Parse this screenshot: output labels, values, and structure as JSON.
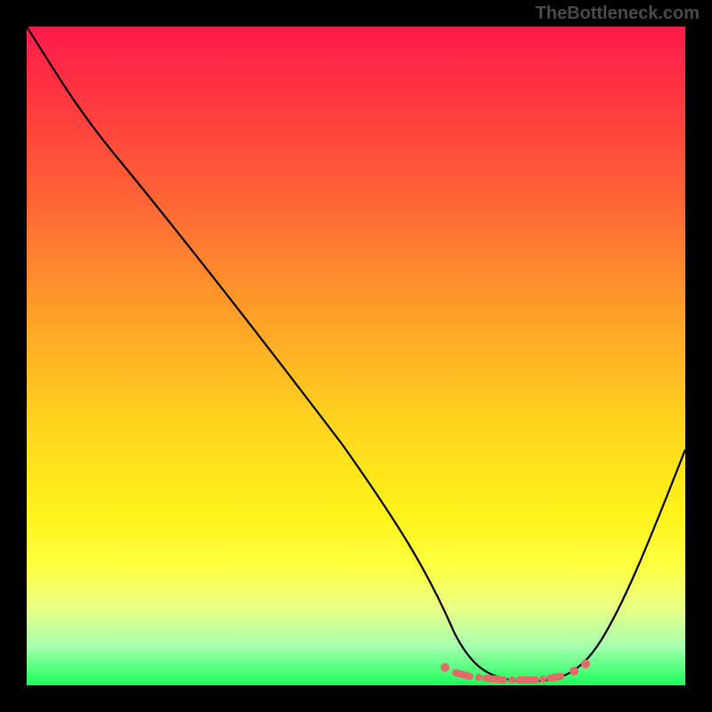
{
  "watermark": "TheBottleneck.com",
  "chart_data": {
    "type": "line",
    "title": "",
    "xlabel": "",
    "ylabel": "",
    "xlim": [
      0,
      100
    ],
    "ylim": [
      0,
      100
    ],
    "series": [
      {
        "name": "bottleneck-curve",
        "x": [
          0,
          6,
          14,
          24,
          34,
          44,
          54,
          60,
          64,
          66,
          70,
          74,
          78,
          82,
          86,
          90,
          94,
          100
        ],
        "y": [
          100,
          92,
          83,
          72,
          61,
          49,
          37,
          28,
          20,
          14,
          6,
          2,
          1,
          1,
          3,
          10,
          20,
          36
        ]
      }
    ],
    "markers": {
      "name": "highlight-region",
      "x_range": [
        63,
        84
      ],
      "y": 1.5,
      "style": "dashed-dots",
      "color": "#e36a6a"
    },
    "gradient": {
      "orientation": "vertical",
      "stops": [
        {
          "pos": 0,
          "color": "#ff1a4a"
        },
        {
          "pos": 0.5,
          "color": "#ffd41e"
        },
        {
          "pos": 0.82,
          "color": "#fdff40"
        },
        {
          "pos": 1.0,
          "color": "#19ff5a"
        }
      ]
    }
  }
}
